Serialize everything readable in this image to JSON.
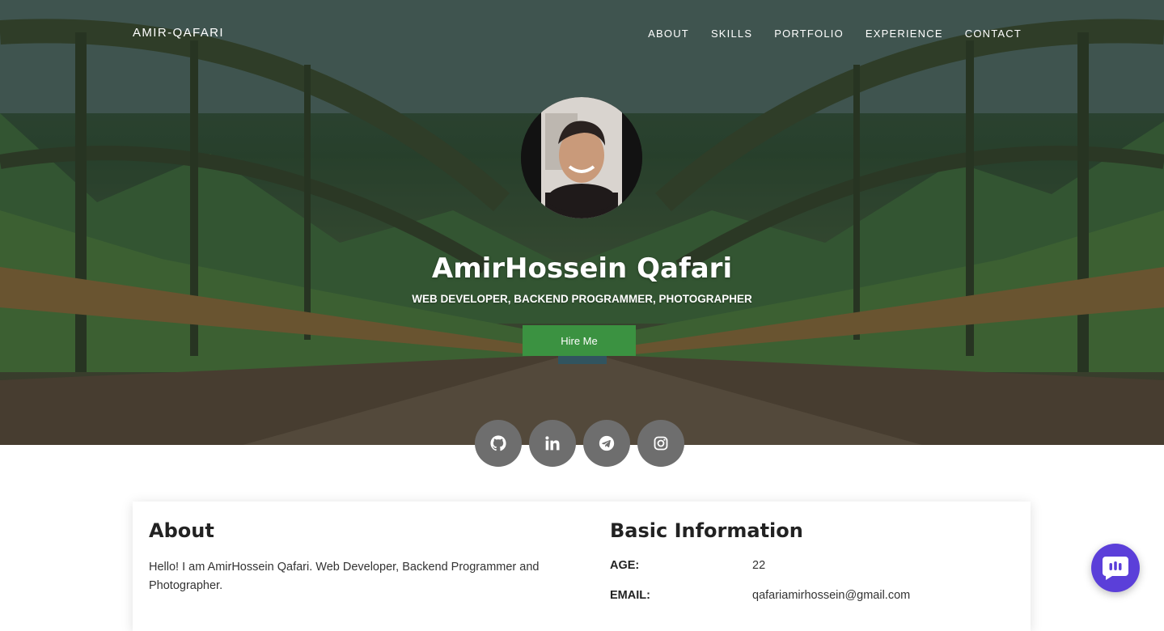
{
  "navbar": {
    "brand": "AMIR-QAFARI",
    "items": [
      {
        "label": "ABOUT"
      },
      {
        "label": "SKILLS"
      },
      {
        "label": "PORTFOLIO"
      },
      {
        "label": "EXPERIENCE"
      },
      {
        "label": "CONTACT"
      }
    ]
  },
  "hero": {
    "name": "AmirHossein Qafari",
    "subtitle": "WEB DEVELOPER, BACKEND PROGRAMMER, PHOTOGRAPHER",
    "cta_label": "Hire Me",
    "cta_color": "#3b9241"
  },
  "socials": [
    {
      "icon": "github-icon"
    },
    {
      "icon": "linkedin-icon"
    },
    {
      "icon": "telegram-icon"
    },
    {
      "icon": "instagram-icon"
    }
  ],
  "about": {
    "title": "About",
    "text": "Hello! I am AmirHossein Qafari. Web Developer, Backend Programmer and Photographer."
  },
  "basic_info": {
    "title": "Basic Information",
    "rows": [
      {
        "label": "AGE:",
        "value": "22"
      },
      {
        "label": "EMAIL:",
        "value": "qafariamirhossein@gmail.com"
      }
    ]
  },
  "chat_widget": {
    "icon": "chat-icon",
    "color": "#5b3fd9"
  }
}
